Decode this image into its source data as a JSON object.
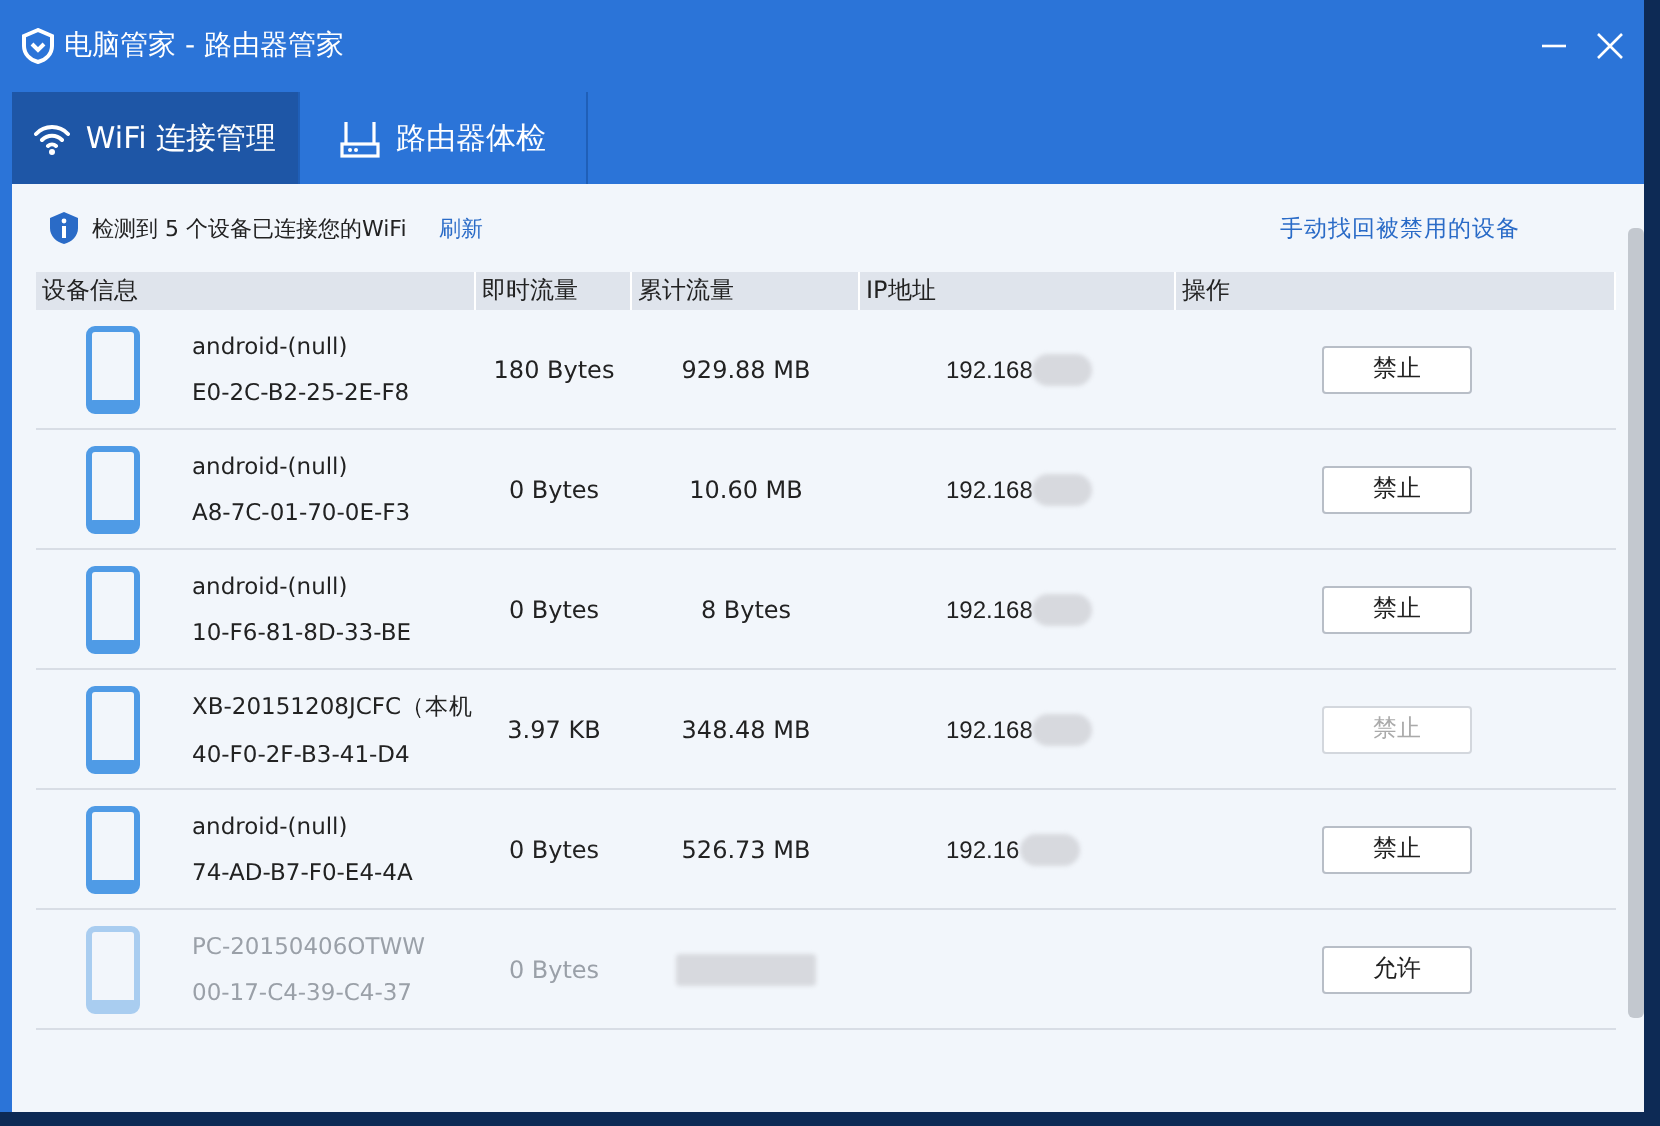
{
  "window": {
    "title": "电脑管家 - 路由器管家"
  },
  "tabs": [
    {
      "label": "WiFi 连接管理",
      "selected": true
    },
    {
      "label": "路由器体检",
      "selected": false
    }
  ],
  "notice": {
    "text": "检测到 5 个设备已连接您的WiFi",
    "refresh": "刷新",
    "recover_link": "手动找回被禁用的设备"
  },
  "table": {
    "columns": [
      "设备信息",
      "即时流量",
      "累计流量",
      "IP地址",
      "操作"
    ],
    "rows": [
      {
        "name": "android-(null)",
        "mac": "E0-2C-B2-25-2E-F8",
        "instant": "180 Bytes",
        "total": "929.88 MB",
        "ip": "192.168",
        "action": "禁止",
        "action_disabled": false,
        "blocked": false
      },
      {
        "name": "android-(null)",
        "mac": "A8-7C-01-70-0E-F3",
        "instant": "0 Bytes",
        "total": "10.60 MB",
        "ip": "192.168",
        "action": "禁止",
        "action_disabled": false,
        "blocked": false
      },
      {
        "name": "android-(null)",
        "mac": "10-F6-81-8D-33-BE",
        "instant": "0 Bytes",
        "total": "8 Bytes",
        "ip": "192.168",
        "action": "禁止",
        "action_disabled": false,
        "blocked": false
      },
      {
        "name": "XB-20151208JCFC（本机",
        "mac": "40-F0-2F-B3-41-D4",
        "instant": "3.97 KB",
        "total": "348.48 MB",
        "ip": "192.168",
        "action": "禁止",
        "action_disabled": true,
        "blocked": false
      },
      {
        "name": "android-(null)",
        "mac": "74-AD-B7-F0-E4-4A",
        "instant": "0 Bytes",
        "total": "526.73 MB",
        "ip": "192.16",
        "action": "禁止",
        "action_disabled": false,
        "blocked": false
      },
      {
        "name": "PC-20150406OTWW",
        "mac": "00-17-C4-39-C4-37",
        "instant": "0 Bytes",
        "action": "允许",
        "action_disabled": false,
        "blocked": true
      }
    ]
  }
}
